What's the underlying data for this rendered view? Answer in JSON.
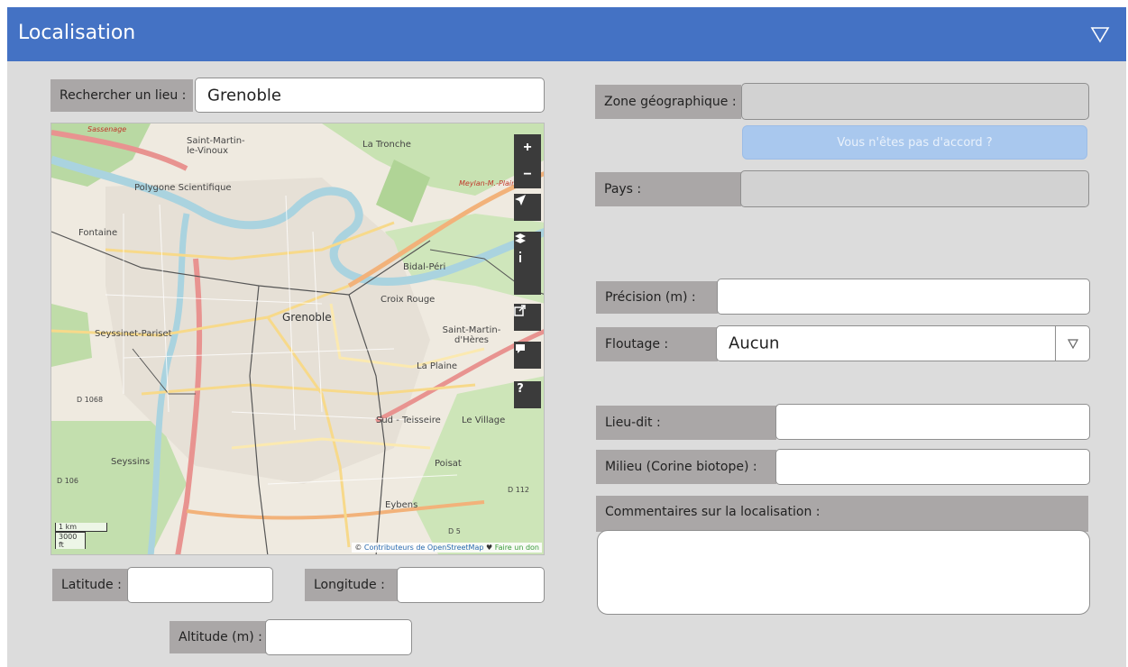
{
  "header": {
    "title": "Localisation",
    "collapse_icon": "triangle-down-outline-icon"
  },
  "search": {
    "label": "Rechercher un lieu :",
    "value": "Grenoble"
  },
  "map": {
    "zoom_in_label": "+",
    "zoom_out_label": "−",
    "labels": {
      "sassenage": "Sassenage",
      "saint_martin_le_vinoux": "Saint-Martin-le-Vinoux",
      "la_tronche": "La Tronche",
      "meylan": "Meylan-M.-Plaine",
      "polygone": "Polygone Scientifique",
      "fontaine": "Fontaine",
      "bidal": "Bidal-Péri",
      "grenoble": "Grenoble",
      "croix_rouge": "Croix Rouge",
      "seyssinet": "Seyssinet-Pariset",
      "saint_martin_dheres": "Saint-Martin-d'Hères",
      "la_plaine": "La Plaine",
      "sud_teisseire": "Sud - Teisseire",
      "le_village": "Le Village",
      "seyssins": "Seyssins",
      "poisat": "Poisat",
      "eybens": "Eybens",
      "d1068": "D 1068",
      "d106": "D 106",
      "d112": "D 112",
      "d5": "D 5"
    },
    "scale_km": "1 km",
    "scale_ft": "3000 ft",
    "attribution_prefix": "© ",
    "attribution_osm": "Contributeurs de OpenStreetMap",
    "attribution_heart": " ♥ ",
    "attribution_don": "Faire un don"
  },
  "coords": {
    "latitude_label": "Latitude :",
    "latitude_value": "",
    "longitude_label": "Longitude  :",
    "longitude_value": "",
    "altitude_label": "Altitude (m) :",
    "altitude_value": ""
  },
  "right": {
    "zone_label": "Zone géographique :",
    "zone_value": "",
    "disagree_button": "Vous n'êtes pas d'accord ?",
    "pays_label": "Pays :",
    "pays_value": "",
    "precision_label": "Précision (m) :",
    "precision_value": "",
    "floutage_label": "Floutage :",
    "floutage_value": "Aucun",
    "lieudit_label": "Lieu-dit :",
    "lieudit_value": "",
    "milieu_label": "Milieu (Corine biotope) :",
    "milieu_value": "",
    "comment_label": "Commentaires sur la localisation :",
    "comment_value": ""
  },
  "colors": {
    "header": "#4472c4",
    "panel": "#dcdcdc",
    "label_bg": "#aaa7a7",
    "disagree_button": "#a9c8ee"
  }
}
